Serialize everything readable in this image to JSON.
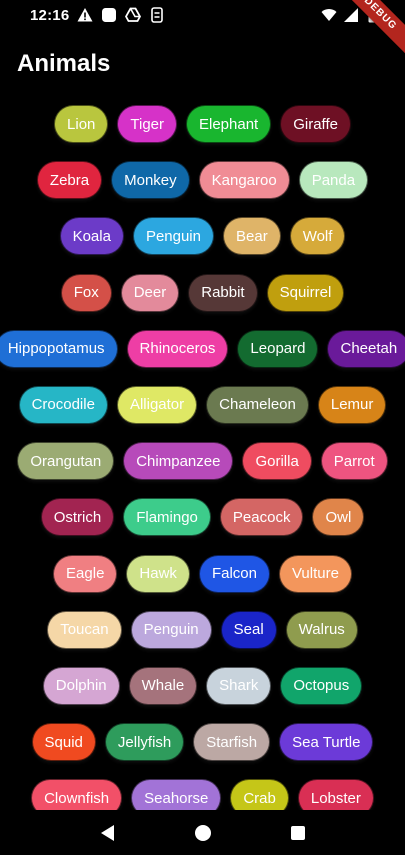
{
  "status_bar": {
    "time": "12:16",
    "icons_left": [
      "warning-icon",
      "square-icon",
      "drive-icon",
      "sync-icon"
    ],
    "icons_right": [
      "wifi-icon",
      "cell-signal-icon",
      "battery-icon"
    ]
  },
  "debug_banner": {
    "label": "DEBUG"
  },
  "header": {
    "title": "Animals"
  },
  "rows": [
    [
      {
        "label": "Lion",
        "color": "#b9c63e"
      },
      {
        "label": "Tiger",
        "color": "#d632c8"
      },
      {
        "label": "Elephant",
        "color": "#19b62f"
      },
      {
        "label": "Giraffe",
        "color": "#6e1024"
      }
    ],
    [
      {
        "label": "Zebra",
        "color": "#e0253f"
      },
      {
        "label": "Monkey",
        "color": "#0f68a8"
      },
      {
        "label": "Kangaroo",
        "color": "#f08c95"
      },
      {
        "label": "Panda",
        "color": "#b8e8bd"
      }
    ],
    [
      {
        "label": "Koala",
        "color": "#6c3bc8"
      },
      {
        "label": "Penguin",
        "color": "#2ca7e0"
      },
      {
        "label": "Bear",
        "color": "#dfb468"
      },
      {
        "label": "Wolf",
        "color": "#d6aa3a"
      }
    ],
    [
      {
        "label": "Fox",
        "color": "#d45048"
      },
      {
        "label": "Deer",
        "color": "#e38a9b"
      },
      {
        "label": "Rabbit",
        "color": "#563837"
      },
      {
        "label": "Squirrel",
        "color": "#c09f0e"
      }
    ],
    [
      {
        "label": "Hippopotamus",
        "color": "#1f6fd6"
      },
      {
        "label": "Rhinoceros",
        "color": "#ee3ea5"
      },
      {
        "label": "Leopard",
        "color": "#136b30"
      },
      {
        "label": "Cheetah",
        "color": "#6a1a9a"
      }
    ],
    [
      {
        "label": "Crocodile",
        "color": "#26b6c6"
      },
      {
        "label": "Alligator",
        "color": "#dfe865"
      },
      {
        "label": "Chameleon",
        "color": "#6b7a50"
      },
      {
        "label": "Lemur",
        "color": "#d78418"
      }
    ],
    [
      {
        "label": "Orangutan",
        "color": "#9bab73"
      },
      {
        "label": "Chimpanzee",
        "color": "#b74aba"
      },
      {
        "label": "Gorilla",
        "color": "#ef4c60"
      },
      {
        "label": "Parrot",
        "color": "#ee5480"
      }
    ],
    [
      {
        "label": "Ostrich",
        "color": "#a22451"
      },
      {
        "label": "Flamingo",
        "color": "#3dcc8b"
      },
      {
        "label": "Peacock",
        "color": "#d46664"
      },
      {
        "label": "Owl",
        "color": "#e0854a"
      }
    ],
    [
      {
        "label": "Eagle",
        "color": "#f07f82"
      },
      {
        "label": "Hawk",
        "color": "#cfe28a"
      },
      {
        "label": "Falcon",
        "color": "#1f56e5"
      },
      {
        "label": "Vulture",
        "color": "#f3965c"
      }
    ],
    [
      {
        "label": "Toucan",
        "color": "#f5d7a7"
      },
      {
        "label": "Penguin",
        "color": "#bca8dd"
      },
      {
        "label": "Seal",
        "color": "#1a25c9"
      },
      {
        "label": "Walrus",
        "color": "#8f9c4e"
      }
    ],
    [
      {
        "label": "Dolphin",
        "color": "#d5a6d3"
      },
      {
        "label": "Whale",
        "color": "#a5737c"
      },
      {
        "label": "Shark",
        "color": "#c8d3dc"
      },
      {
        "label": "Octopus",
        "color": "#11a56b"
      }
    ],
    [
      {
        "label": "Squid",
        "color": "#f04a20"
      },
      {
        "label": "Jellyfish",
        "color": "#2e9c5c"
      },
      {
        "label": "Starfish",
        "color": "#bca8a4"
      },
      {
        "label": "Sea Turtle",
        "color": "#6c3ad8"
      }
    ],
    [
      {
        "label": "Clownfish",
        "color": "#f25068"
      },
      {
        "label": "Seahorse",
        "color": "#a273d7"
      },
      {
        "label": "Crab",
        "color": "#c5c618"
      },
      {
        "label": "Lobster",
        "color": "#d92f54"
      }
    ]
  ],
  "nav_bar": {
    "buttons": [
      "back-icon",
      "home-icon",
      "recents-icon"
    ]
  }
}
